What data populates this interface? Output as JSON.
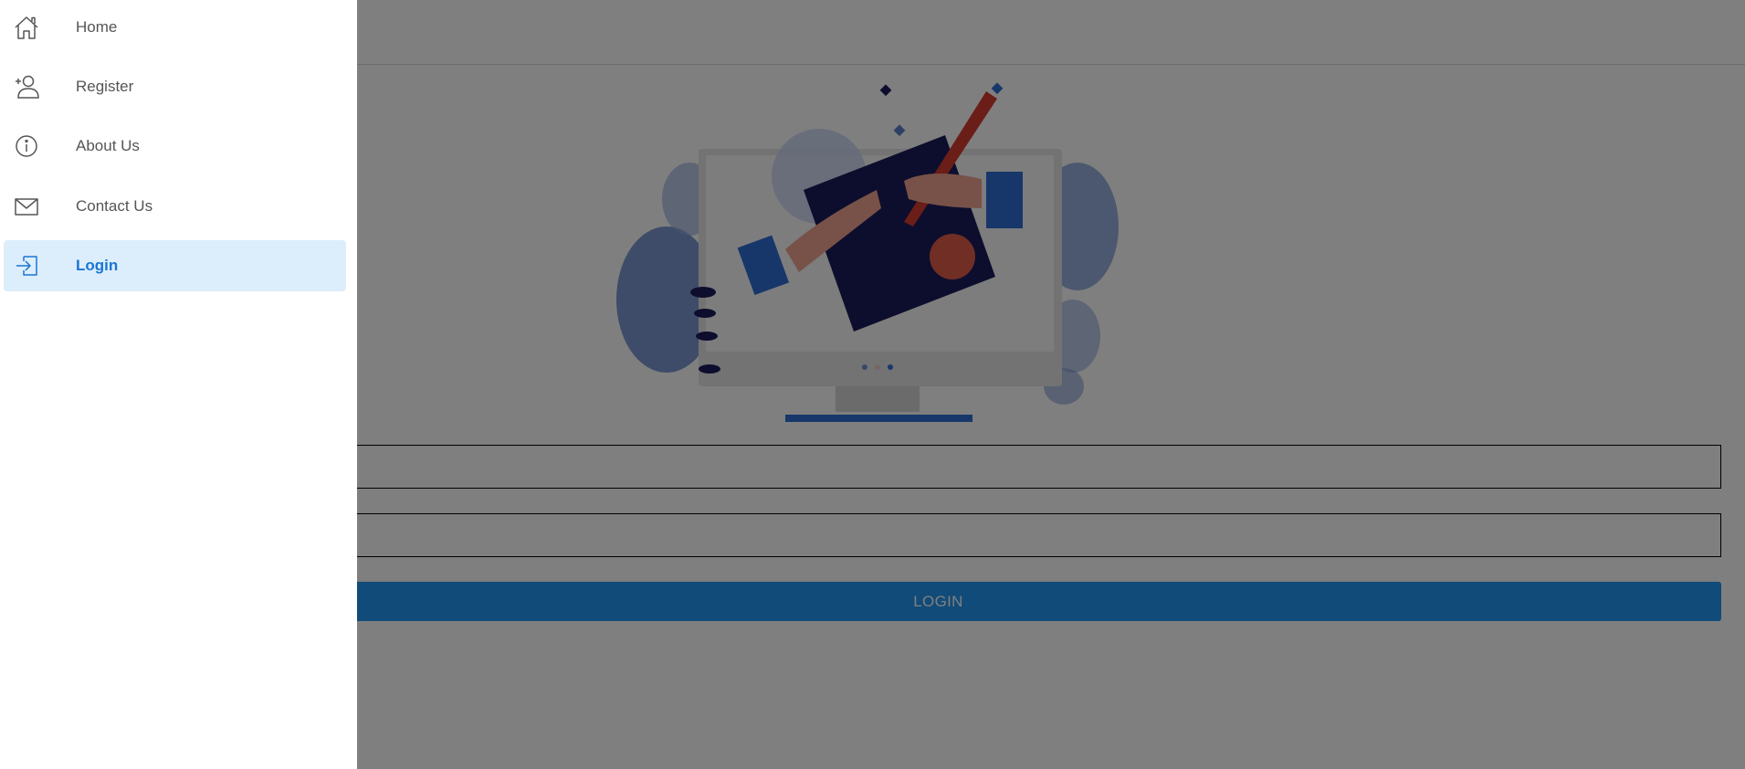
{
  "drawer": {
    "items": [
      {
        "label": "Home",
        "icon": "home-icon",
        "active": false
      },
      {
        "label": "Register",
        "icon": "person-add-icon",
        "active": false
      },
      {
        "label": "About Us",
        "icon": "info-icon",
        "active": false
      },
      {
        "label": "Contact Us",
        "icon": "mail-icon",
        "active": false
      },
      {
        "label": "Login",
        "icon": "login-icon",
        "active": true
      }
    ]
  },
  "login_form": {
    "email_value": "",
    "password_value": "",
    "button_label": "LOGIN"
  },
  "colors": {
    "primary": "#2196f3",
    "active_item_background": "#dcedfc",
    "active_item_text": "#1976d2",
    "overlay": "rgba(0,0,0,0.5)"
  }
}
